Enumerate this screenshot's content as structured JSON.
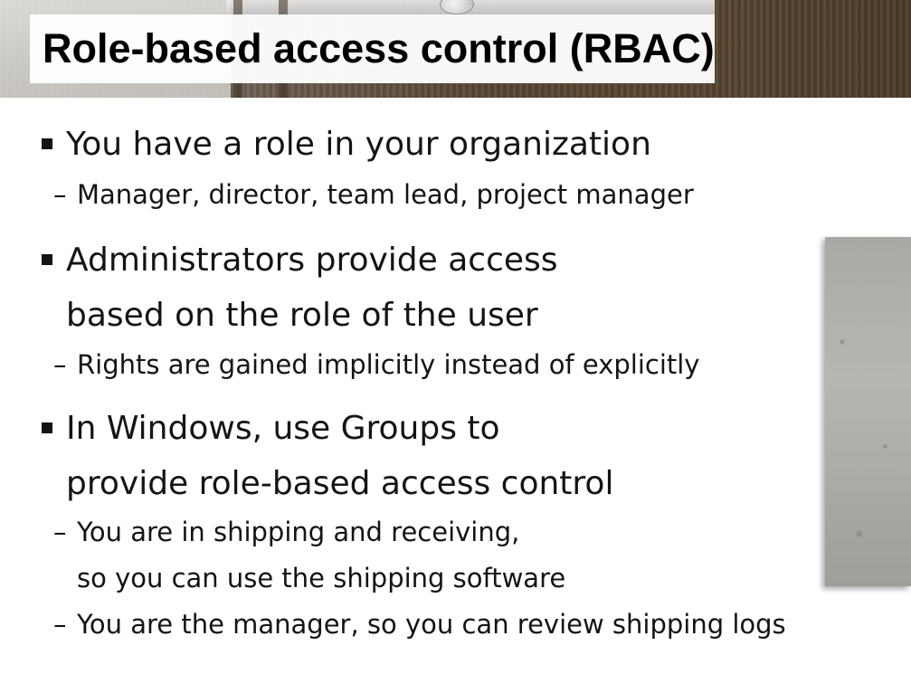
{
  "slide": {
    "title": "Role-based access control (RBAC)",
    "bullets": [
      {
        "lines": [
          "You have a role in your organization"
        ],
        "subs": [
          {
            "lines": [
              "Manager, director, team lead, project manager"
            ]
          }
        ]
      },
      {
        "lines": [
          "Administrators provide access",
          "based on the role of the user"
        ],
        "subs": [
          {
            "lines": [
              "Rights are gained implicitly instead of explicitly"
            ]
          }
        ]
      },
      {
        "lines": [
          "In Windows, use Groups to",
          "provide role-based access control"
        ],
        "subs": [
          {
            "lines": [
              "You are in shipping and receiving,",
              "so you can use the shipping software"
            ]
          },
          {
            "lines": [
              "You are the manager, so you can review shipping logs"
            ]
          }
        ]
      }
    ],
    "dash_glyph": "–"
  }
}
